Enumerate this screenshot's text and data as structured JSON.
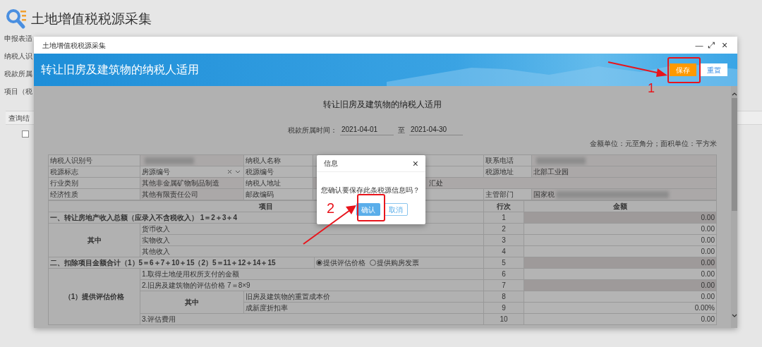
{
  "page": {
    "title": "土地增值税税源采集",
    "form_labels": [
      "申报表适",
      "纳税人识",
      "税款所属",
      "项目（税"
    ],
    "results_header": "查询结",
    "results_checkbox": {
      "checked": false
    }
  },
  "window": {
    "title": "土地增值税税源采集",
    "minimize": "—",
    "maximize": "⤢",
    "close": "×"
  },
  "banner": {
    "title": "转让旧房及建筑物的纳税人适用",
    "buttons": [
      {
        "label": "保存",
        "kind": "primary"
      },
      {
        "label": "重置",
        "kind": "secondary"
      }
    ]
  },
  "form": {
    "title": "转让旧房及建筑物的纳税人适用",
    "period_label": "税款所属时间：",
    "period_from": "2021-04-01",
    "period_sep": "至",
    "period_to": "2021-04-30",
    "units": "金额单位：元至角分；面积单位：平方米",
    "info_rows": [
      [
        {
          "kind": "label",
          "text": "纳税人识别号"
        },
        {
          "kind": "redacted"
        },
        {
          "kind": "label",
          "text": "纳税人名称"
        },
        {
          "kind": "none"
        },
        {
          "kind": "label",
          "text": "联系电话"
        },
        {
          "kind": "redacted"
        }
      ],
      [
        {
          "kind": "label",
          "text": "税源标志"
        },
        {
          "kind": "select",
          "text": "房源编号"
        },
        {
          "kind": "label",
          "text": "税源编号"
        },
        {
          "kind": "none"
        },
        {
          "kind": "label",
          "text": "税源地址"
        },
        {
          "kind": "value",
          "text": "北部工业园"
        }
      ],
      [
        {
          "kind": "label",
          "text": "行业类别"
        },
        {
          "kind": "value",
          "text": "其他非金属矿物制品制造"
        },
        {
          "kind": "label",
          "text": "纳税人地址"
        },
        {
          "kind": "tail",
          "text": "汇处"
        },
        {
          "kind": "none"
        },
        {
          "kind": "none"
        }
      ],
      [
        {
          "kind": "label",
          "text": "经济性质"
        },
        {
          "kind": "value",
          "text": "其他有限责任公司"
        },
        {
          "kind": "label",
          "text": "邮政编码"
        },
        {
          "kind": "none"
        },
        {
          "kind": "label",
          "text": "主管部门"
        },
        {
          "kind": "partial",
          "text": "国家税"
        }
      ]
    ],
    "columns": [
      "项目",
      "行次",
      "金额"
    ],
    "sections": [
      {
        "title": "一、转让房地产收入总额（应录入不含税收入） 1＝2＋3＋4",
        "line": "1",
        "amount": "0.00",
        "locked": true,
        "groups": [
          {
            "label": "其中",
            "items": [
              {
                "kind": "item",
                "text": "货币收入",
                "line": "2",
                "amount": "0.00",
                "locked": false
              },
              {
                "kind": "item",
                "text": "实物收入",
                "line": "3",
                "amount": "0.00",
                "locked": false
              },
              {
                "kind": "item",
                "text": "其他收入",
                "line": "4",
                "amount": "0.00",
                "locked": false
              }
            ]
          }
        ]
      },
      {
        "title": "二、扣除项目金额合计（1）5＝6＋7＋10＋15（2）5＝11＋12＋14＋15",
        "options": [
          {
            "label": "提供评估价格",
            "selected": true
          },
          {
            "label": "提供购房发票",
            "selected": false
          }
        ],
        "line": "5",
        "amount": "0.00",
        "locked": true,
        "groups": [
          {
            "label": "（1）提供评估价格",
            "items": [
              {
                "kind": "item",
                "text": "1.取得土地使用权所支付的金额",
                "line": "6",
                "amount": "0.00",
                "locked": false
              },
              {
                "kind": "item",
                "text": "2.旧房及建筑物的评估价格 7＝8×9",
                "line": "7",
                "amount": "0.00",
                "locked": true
              },
              {
                "kind": "subgroup",
                "label": "其中",
                "items": [
                  {
                    "kind": "item",
                    "text": "旧房及建筑物的重置成本价",
                    "line": "8",
                    "amount": "0.00",
                    "locked": false
                  },
                  {
                    "kind": "item",
                    "text": "成新度折扣率",
                    "line": "9",
                    "amount": "0.00%",
                    "locked": false
                  }
                ]
              },
              {
                "kind": "item",
                "text": "3.评估费用",
                "line": "10",
                "amount": "0.00",
                "locked": false
              }
            ]
          }
        ]
      }
    ]
  },
  "dialog": {
    "title": "信息",
    "close": "×",
    "message": "您确认要保存此条税源信息吗？",
    "buttons": [
      {
        "label": "确认",
        "kind": "primary"
      },
      {
        "label": "取消",
        "kind": "secondary"
      }
    ]
  },
  "annotations": [
    {
      "label": "1"
    },
    {
      "label": "2"
    }
  ]
}
